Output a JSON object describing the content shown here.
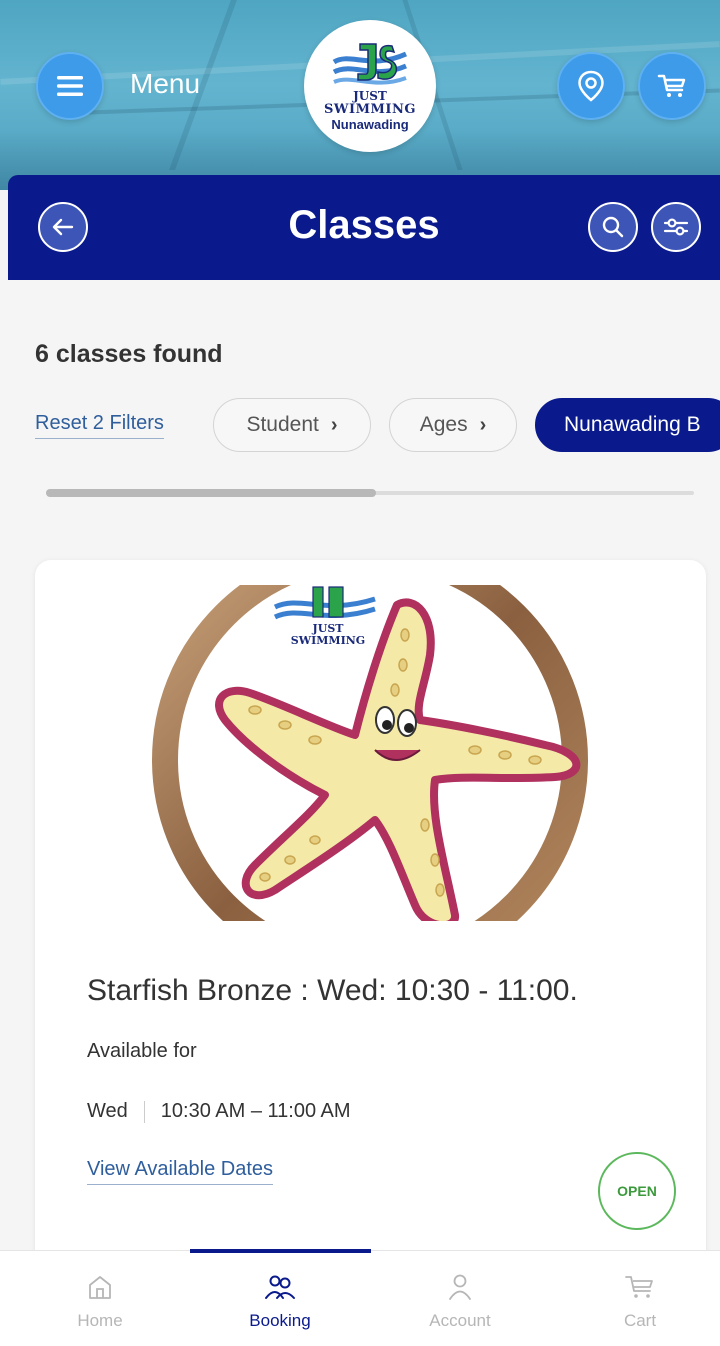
{
  "header": {
    "menu_label": "Menu",
    "logo": {
      "line1": "JUST",
      "line2": "SWIMMING",
      "line3": "Nunawading"
    }
  },
  "page": {
    "title": "Classes"
  },
  "results": {
    "count_text": "6 classes found",
    "reset_label": "Reset 2 Filters",
    "filters": [
      {
        "label": "Student",
        "active": false
      },
      {
        "label": "Ages",
        "active": false
      },
      {
        "label": "Nunawading B",
        "active": true
      }
    ]
  },
  "class_card": {
    "image_logo_line1": "JUST",
    "image_logo_line2": "SWIMMING",
    "name": "Starfish Bronze : Wed: 10:30 - 11:00.",
    "available_label": "Available for",
    "day": "Wed",
    "time": "10:30 AM – 11:00 AM",
    "view_dates_label": "View Available Dates",
    "status": "OPEN"
  },
  "nav": {
    "items": [
      {
        "label": "Home",
        "icon": "home-icon",
        "active": false
      },
      {
        "label": "Booking",
        "icon": "people-icon",
        "active": true
      },
      {
        "label": "Account",
        "icon": "person-icon",
        "active": false
      },
      {
        "label": "Cart",
        "icon": "cart-icon",
        "active": false
      }
    ]
  },
  "colors": {
    "primary_navy": "#0a1a8c",
    "accent_blue": "#3d9be9",
    "link_blue": "#2f5e9c",
    "open_green": "#5cb85c"
  }
}
